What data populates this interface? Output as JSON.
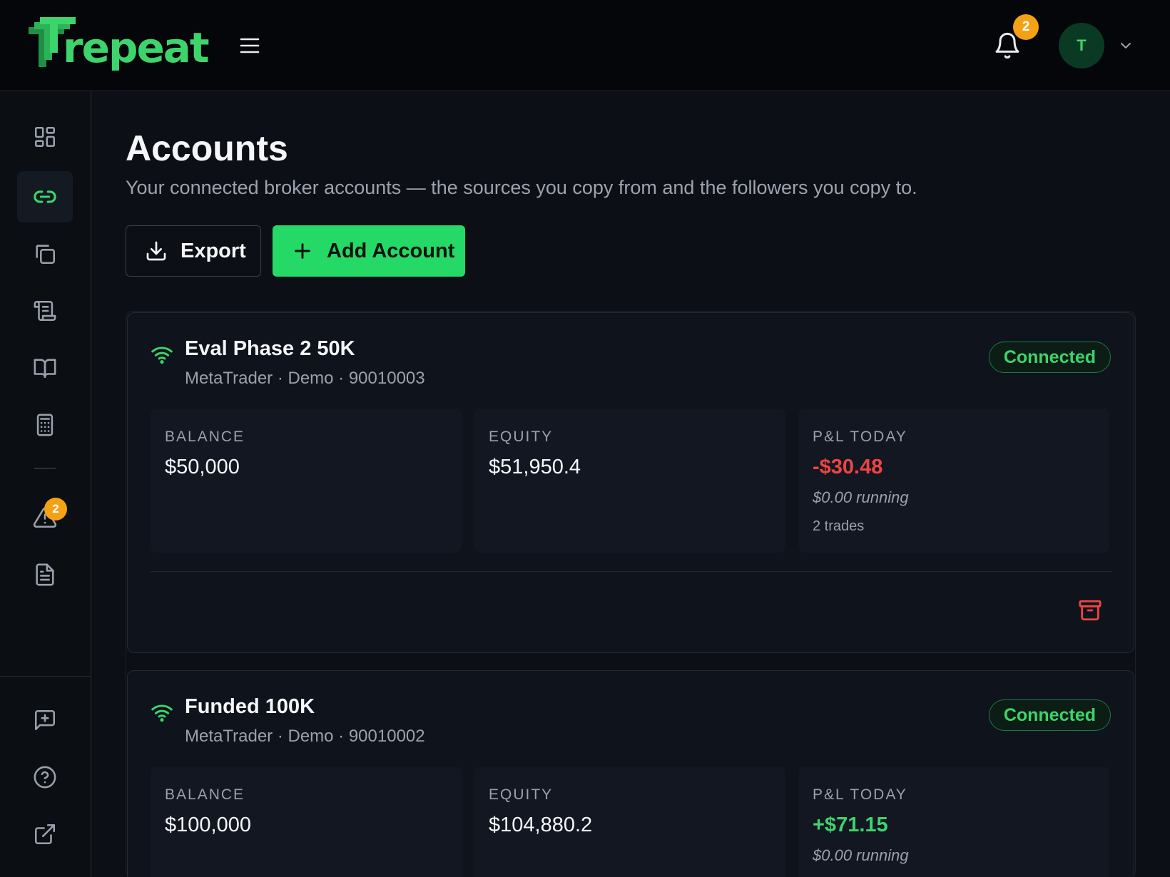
{
  "brand": {
    "name": "repeat",
    "accent": "#3dd46b"
  },
  "header": {
    "menu_icon": "hamburger-icon",
    "notifications_count": "2",
    "avatar_initial": "T"
  },
  "sidebar": {
    "items": [
      {
        "icon": "dashboard-icon"
      },
      {
        "icon": "link-icon",
        "active": true
      },
      {
        "icon": "copy-icon"
      },
      {
        "icon": "scroll-icon"
      },
      {
        "icon": "book-icon"
      },
      {
        "icon": "calculator-icon"
      },
      {
        "icon": "alert-icon",
        "badge": "2"
      },
      {
        "icon": "document-icon"
      },
      {
        "icon": "feedback-icon"
      },
      {
        "icon": "help-icon"
      },
      {
        "icon": "external-link-icon"
      }
    ]
  },
  "page": {
    "title": "Accounts",
    "subtitle": "Your connected broker accounts — the sources you copy from and the followers you copy to."
  },
  "actions": {
    "export_label": "Export",
    "add_label": "Add Account"
  },
  "accounts": [
    {
      "name": "Eval Phase 2 50K",
      "meta": "MetaTrader · Demo · 90010003",
      "status": "Connected",
      "balance_label": "BALANCE",
      "balance": "$50,000",
      "equity_label": "EQUITY",
      "equity": "$51,950.4",
      "pnl_label": "P&L TODAY",
      "pnl": "-$30.48",
      "running": "$0.00 running",
      "trades": "2 trades"
    },
    {
      "name": "Funded 100K",
      "meta": "MetaTrader · Demo · 90010002",
      "status": "Connected",
      "balance_label": "BALANCE",
      "balance": "$100,000",
      "equity_label": "EQUITY",
      "equity": "$104,880.2",
      "pnl_label": "P&L TODAY",
      "pnl": "+$71.15",
      "running": "$0.00 running"
    }
  ],
  "colors": {
    "positive": "#3dd46b",
    "negative": "#ef4444",
    "badge": "#f5a116",
    "button": "#25d967"
  }
}
